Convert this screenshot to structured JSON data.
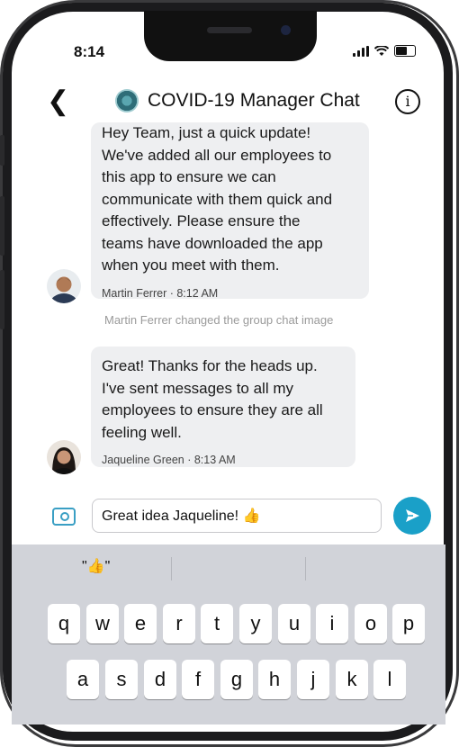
{
  "status_bar": {
    "time": "8:14"
  },
  "header": {
    "title": "COVID-19 Manager Chat"
  },
  "messages": [
    {
      "text": "Hey Team, just a quick update!\nWe've added all our employees to\nthis app to ensure we can\ncommunicate with them quick and\neffectively. Please ensure the\nteams have downloaded the app\nwhen you meet with them.",
      "meta": "Martin Ferrer · 8:12 AM"
    },
    {
      "text": "Great! Thanks for the heads up.\nI've sent messages to all my\nemployees to ensure they are all\nfeeling well.",
      "meta": "Jaqueline Green · 8:13 AM"
    }
  ],
  "system_message": "Martin Ferrer changed the group chat image",
  "composer": {
    "value": "Great idea Jaqueline! 👍"
  },
  "keyboard": {
    "suggestion": "\"👍\"",
    "row1": [
      "q",
      "w",
      "e",
      "r",
      "t",
      "y",
      "u",
      "i",
      "o",
      "p"
    ],
    "row2": [
      "a",
      "s",
      "d",
      "f",
      "g",
      "h",
      "j",
      "k",
      "l"
    ]
  },
  "colors": {
    "accent": "#1aa0c8",
    "bubble": "#eeeff1",
    "keyboard_bg": "#d1d3d9"
  }
}
